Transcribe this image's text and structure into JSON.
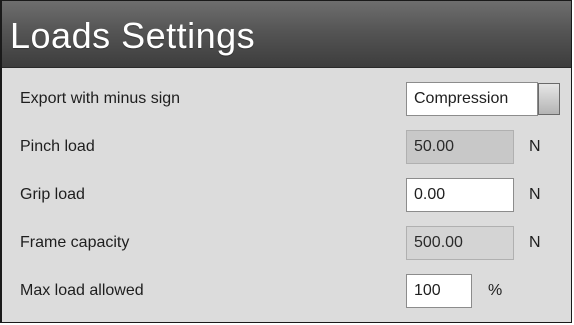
{
  "window": {
    "title": "Loads Settings"
  },
  "rows": [
    {
      "label": "Export with minus sign",
      "value": "Compression"
    },
    {
      "label": "Pinch load",
      "value": "50.00",
      "unit": "N"
    },
    {
      "label": "Grip load",
      "value": "0.00",
      "unit": "N"
    },
    {
      "label": "Frame capacity",
      "value": "500.00",
      "unit": "N"
    },
    {
      "label": "Max load allowed",
      "value": "100",
      "unit": "%"
    }
  ]
}
